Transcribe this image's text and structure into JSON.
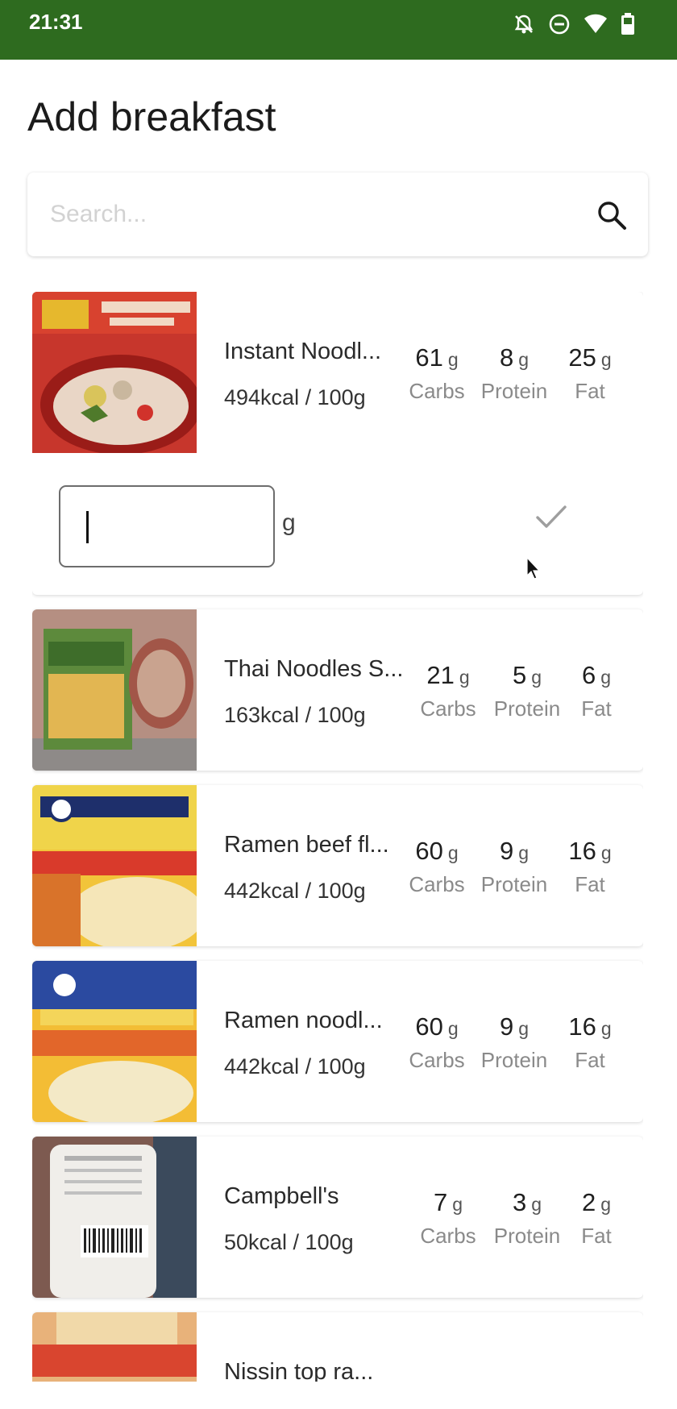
{
  "status_bar": {
    "time": "21:31"
  },
  "page": {
    "title": "Add breakfast"
  },
  "search": {
    "placeholder": "Search..."
  },
  "macro_labels": {
    "carbs": "Carbs",
    "protein": "Protein",
    "fat": "Fat"
  },
  "unit": "g",
  "expanded_item": {
    "amount_value": "",
    "amount_unit": "g"
  },
  "items": [
    {
      "name": "Instant Noodl...",
      "kcal": "494kcal / 100g",
      "carbs": "61",
      "protein": "8",
      "fat": "25"
    },
    {
      "name": "Thai Noodles S...",
      "kcal": "163kcal / 100g",
      "carbs": "21",
      "protein": "5",
      "fat": "6"
    },
    {
      "name": "Ramen beef fl...",
      "kcal": "442kcal / 100g",
      "carbs": "60",
      "protein": "9",
      "fat": "16"
    },
    {
      "name": "Ramen noodl...",
      "kcal": "442kcal / 100g",
      "carbs": "60",
      "protein": "9",
      "fat": "16"
    },
    {
      "name": "Campbell's",
      "kcal": "50kcal / 100g",
      "carbs": "7",
      "protein": "3",
      "fat": "2"
    },
    {
      "name": "Nissin top ra..."
    }
  ],
  "colors": {
    "status_bar": "#2e6b1f",
    "check": "#9e9e9e"
  }
}
